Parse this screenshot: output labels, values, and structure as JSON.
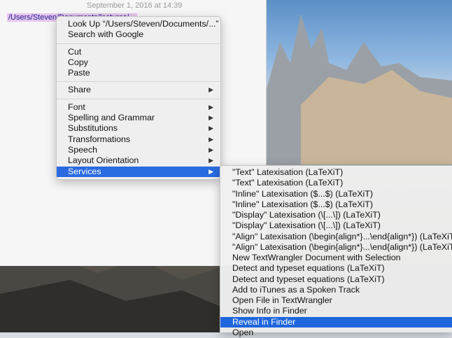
{
  "document": {
    "date": "September 1, 2016 at 14:39",
    "selected_path": "/Users/Steven/Documents/lectures/..."
  },
  "context_menu": {
    "items": [
      {
        "label": "Look Up “/Users/Steven/Documents/...”"
      },
      {
        "label": "Search with Google"
      },
      {
        "label": "Cut"
      },
      {
        "label": "Copy"
      },
      {
        "label": "Paste"
      },
      {
        "label": "Share"
      },
      {
        "label": "Font"
      },
      {
        "label": "Spelling and Grammar"
      },
      {
        "label": "Substitutions"
      },
      {
        "label": "Transformations"
      },
      {
        "label": "Speech"
      },
      {
        "label": "Layout Orientation"
      },
      {
        "label": "Services"
      }
    ],
    "submenu_arrow": "▶"
  },
  "services_menu": {
    "items": [
      {
        "label": "\"Text\" Latexisation (LaTeXiT)"
      },
      {
        "label": "\"Text\" Latexisation (LaTeXiT)"
      },
      {
        "label": "\"Inline\" Latexisation ($...$) (LaTeXiT)"
      },
      {
        "label": "\"Inline\" Latexisation ($...$) (LaTeXiT)"
      },
      {
        "label": "\"Display\" Latexisation (\\[...\\]) (LaTeXiT)"
      },
      {
        "label": "\"Display\" Latexisation (\\[...\\]) (LaTeXiT)"
      },
      {
        "label": "\"Align\" Latexisation (\\begin{align*}...\\end{align*}) (LaTeXiT)"
      },
      {
        "label": "\"Align\" Latexisation (\\begin{align*}...\\end{align*}) (LaTeXiT)"
      },
      {
        "label": "New TextWrangler Document with Selection"
      },
      {
        "label": "Detect and typeset equations (LaTeXiT)"
      },
      {
        "label": "Detect and typeset equations (LaTeXiT)"
      },
      {
        "label": "Add to iTunes as a Spoken Track"
      },
      {
        "label": "Open File in TextWrangler"
      },
      {
        "label": "Show Info in Finder"
      },
      {
        "label": "Reveal in Finder"
      },
      {
        "label": "Open"
      }
    ]
  },
  "colors": {
    "selection": "#2a6ae0",
    "text_highlight": "#e6c6ee"
  }
}
